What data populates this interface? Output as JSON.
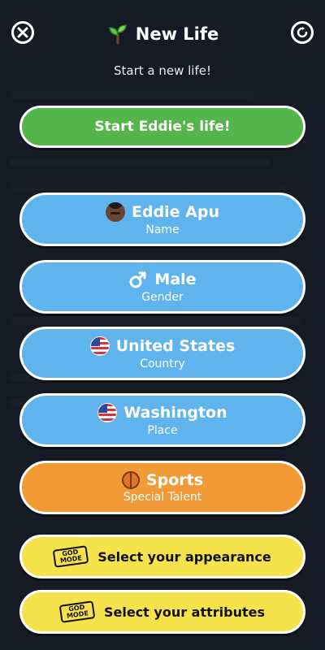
{
  "header": {
    "title": "New Life",
    "subtitle": "Start a new life!",
    "icons": {
      "close": "close-icon",
      "reset": "refresh-icon",
      "title": "sprout-icon"
    }
  },
  "actions": {
    "start_label": "Start Eddie's life!"
  },
  "fields": [
    {
      "key": "name",
      "value": "Eddie Apu",
      "label": "Name",
      "icon": "avatar-icon",
      "color": "#5fb4ee"
    },
    {
      "key": "gender",
      "value": "Male",
      "label": "Gender",
      "icon": "male-symbol-icon",
      "color": "#5fb4ee"
    },
    {
      "key": "country",
      "value": "United States",
      "label": "Country",
      "icon": "us-flag-icon",
      "color": "#5fb4ee"
    },
    {
      "key": "place",
      "value": "Washington",
      "label": "Place",
      "icon": "us-flag-icon",
      "color": "#5fb4ee"
    },
    {
      "key": "talent",
      "value": "Sports",
      "label": "Special Talent",
      "icon": "basketball-icon",
      "color": "#f29a36"
    }
  ],
  "god_mode": {
    "badge": "GOD MODE",
    "appearance_label": "Select your appearance",
    "attributes_label": "Select your attributes"
  },
  "colors": {
    "green": "#53b54a",
    "blue": "#5fb4ee",
    "orange": "#f29a36",
    "yellow": "#f6e24a"
  }
}
